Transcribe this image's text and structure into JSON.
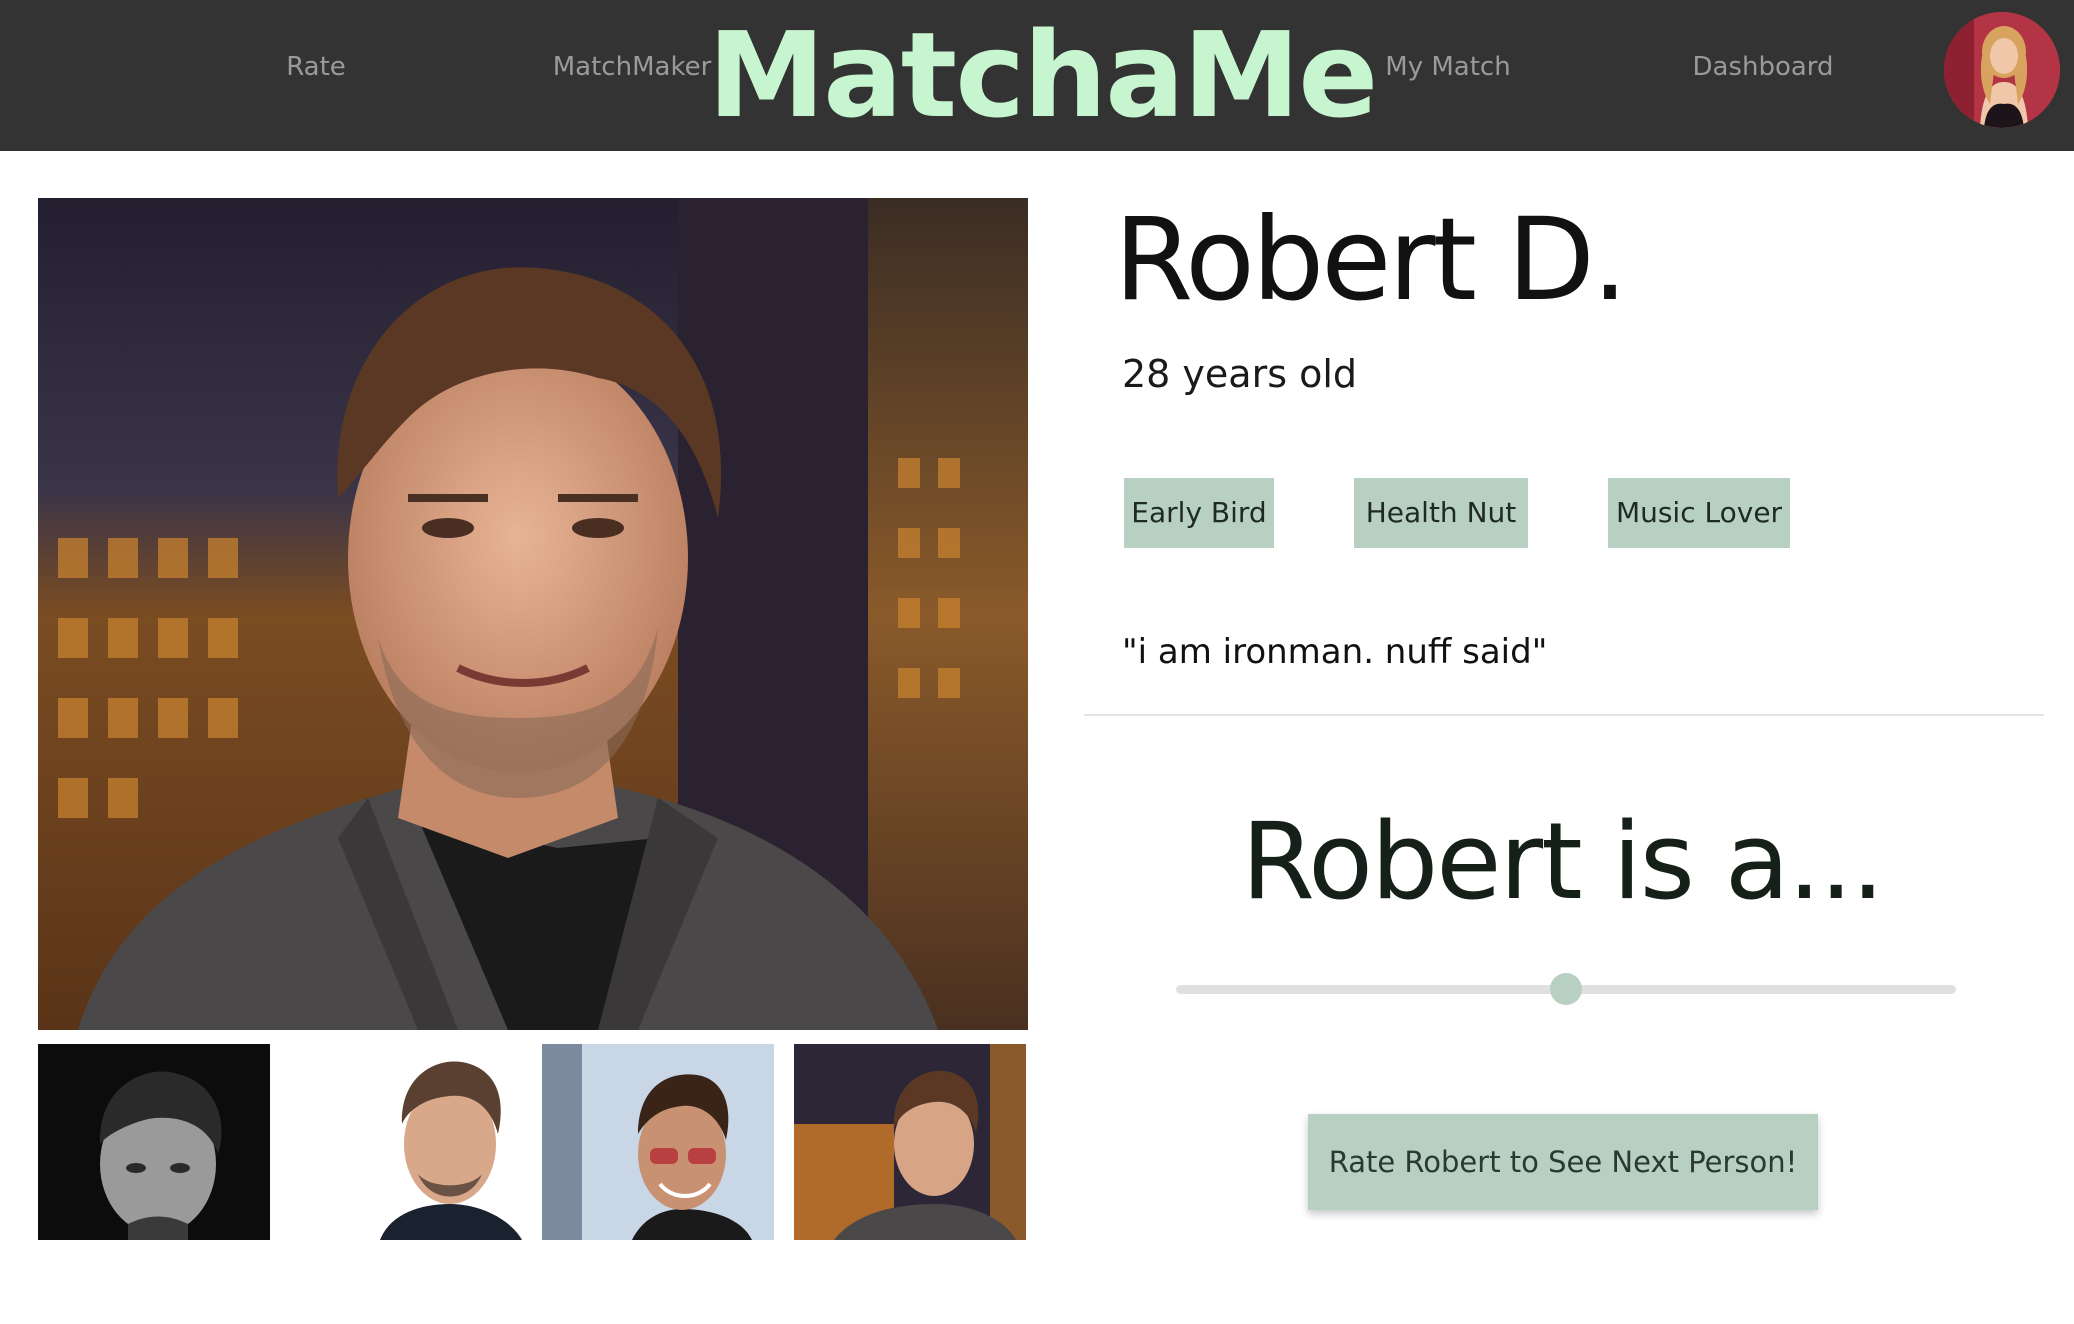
{
  "nav": {
    "links": [
      "Rate",
      "MatchMaker",
      "My Match",
      "Dashboard"
    ],
    "brand": "MatchaMe",
    "brand_color": "#c6f5cf",
    "avatar_icon": "user-avatar"
  },
  "profile": {
    "name": "Robert D.",
    "age": "28 years old",
    "tags": [
      "Early Bird",
      "Health Nut",
      "Music Lover"
    ],
    "quote": "\"i am ironman. nuff said\"",
    "photo_count": 5
  },
  "rating": {
    "heading": "Robert is a...",
    "slider_value": 0.5,
    "button_label": "Rate Robert to See Next Person!"
  },
  "colors": {
    "header_bg": "#333333",
    "accent": "#b8d0c2",
    "nav_text": "#9a9a9a"
  }
}
